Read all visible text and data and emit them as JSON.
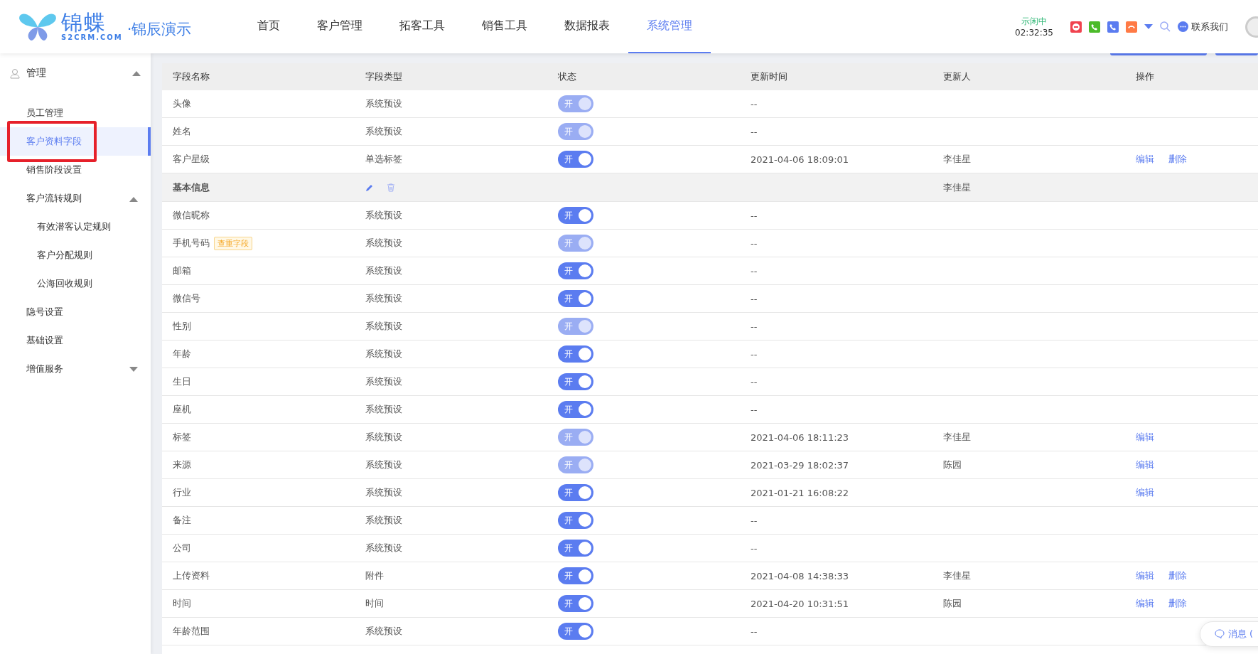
{
  "header": {
    "logo": {
      "mark": "锦蝶",
      "domain": "S2CRM.COM",
      "subtitle": "·锦辰演示"
    },
    "nav": [
      {
        "label": "首页",
        "selected": false
      },
      {
        "label": "客户管理",
        "selected": false
      },
      {
        "label": "拓客工具",
        "selected": false
      },
      {
        "label": "销售工具",
        "selected": false
      },
      {
        "label": "数据报表",
        "selected": false
      },
      {
        "label": "系统管理",
        "selected": true
      }
    ],
    "call_status": {
      "state": "示闲中",
      "timer": "02:32:35"
    },
    "contact": "联系我们"
  },
  "sidebar": {
    "items": [
      {
        "label": "管理",
        "expanded": true,
        "children": [
          {
            "label": "员工管理",
            "selected": false
          },
          {
            "label": "客户资料字段",
            "selected": true,
            "annotated": true
          },
          {
            "label": "销售阶段设置",
            "selected": false
          },
          {
            "label": "客户流转规则",
            "selected": false,
            "expanded": true,
            "children": [
              {
                "label": "有效潜客认定规则",
                "selected": false
              },
              {
                "label": "客户分配规则",
                "selected": false
              },
              {
                "label": "公海回收规则",
                "selected": false
              }
            ]
          },
          {
            "label": "隐号设置",
            "selected": false
          },
          {
            "label": "基础设置",
            "selected": false
          },
          {
            "label": "增值服务",
            "selected": false,
            "expanded": false
          }
        ]
      }
    ]
  },
  "table": {
    "columns": [
      "字段名称",
      "字段类型",
      "状态",
      "更新时间",
      "更新人",
      "操作"
    ],
    "rows": [
      {
        "kind": "field",
        "name": "头像",
        "type": "系统预设",
        "status": {
          "label": "开",
          "disabled": true
        },
        "time": "--"
      },
      {
        "kind": "field",
        "name": "姓名",
        "type": "系统预设",
        "status": {
          "label": "开",
          "disabled": true
        },
        "time": "--"
      },
      {
        "kind": "field",
        "name": "客户星级",
        "type": "单选标签",
        "status": {
          "label": "开",
          "disabled": false
        },
        "time": "2021-04-06 18:09:01",
        "updater": "李佳星",
        "actions": [
          "编辑",
          "删除"
        ]
      },
      {
        "kind": "group",
        "name": "基本信息",
        "updater": "李佳星"
      },
      {
        "kind": "field",
        "name": "微信昵称",
        "type": "系统预设",
        "status": {
          "label": "开",
          "disabled": false
        },
        "time": "--"
      },
      {
        "kind": "field",
        "name": "手机号码",
        "tag": "查重字段",
        "type": "系统预设",
        "status": {
          "label": "开",
          "disabled": true
        },
        "time": "--"
      },
      {
        "kind": "field",
        "name": "邮箱",
        "type": "系统预设",
        "status": {
          "label": "开",
          "disabled": false
        },
        "time": "--"
      },
      {
        "kind": "field",
        "name": "微信号",
        "type": "系统预设",
        "status": {
          "label": "开",
          "disabled": false
        },
        "time": "--"
      },
      {
        "kind": "field",
        "name": "性别",
        "type": "系统预设",
        "status": {
          "label": "开",
          "disabled": true
        },
        "time": "--"
      },
      {
        "kind": "field",
        "name": "年龄",
        "type": "系统预设",
        "status": {
          "label": "开",
          "disabled": false
        },
        "time": "--"
      },
      {
        "kind": "field",
        "name": "生日",
        "type": "系统预设",
        "status": {
          "label": "开",
          "disabled": false
        },
        "time": "--"
      },
      {
        "kind": "field",
        "name": "座机",
        "type": "系统预设",
        "status": {
          "label": "开",
          "disabled": false
        },
        "time": "--"
      },
      {
        "kind": "field",
        "name": "标签",
        "type": "系统预设",
        "status": {
          "label": "开",
          "disabled": true
        },
        "time": "2021-04-06 18:11:23",
        "updater": "李佳星",
        "actions": [
          "编辑"
        ]
      },
      {
        "kind": "field",
        "name": "来源",
        "type": "系统预设",
        "status": {
          "label": "开",
          "disabled": true
        },
        "time": "2021-03-29 18:02:37",
        "updater": "陈园",
        "actions": [
          "编辑"
        ]
      },
      {
        "kind": "field",
        "name": "行业",
        "type": "系统预设",
        "status": {
          "label": "开",
          "disabled": false
        },
        "time": "2021-01-21 16:08:22",
        "actions": [
          "编辑"
        ]
      },
      {
        "kind": "field",
        "name": "备注",
        "type": "系统预设",
        "status": {
          "label": "开",
          "disabled": false
        },
        "time": "--"
      },
      {
        "kind": "field",
        "name": "公司",
        "type": "系统预设",
        "status": {
          "label": "开",
          "disabled": false
        },
        "time": "--"
      },
      {
        "kind": "field",
        "name": "上传资料",
        "type": "附件",
        "status": {
          "label": "开",
          "disabled": false
        },
        "time": "2021-04-08 14:38:33",
        "updater": "李佳星",
        "actions": [
          "编辑",
          "删除"
        ]
      },
      {
        "kind": "field",
        "name": "时间",
        "type": "时间",
        "status": {
          "label": "开",
          "disabled": false
        },
        "time": "2021-04-20 10:31:51",
        "updater": "陈园",
        "actions": [
          "编辑",
          "删除"
        ]
      },
      {
        "kind": "field",
        "name": "年龄范围",
        "type": "系统预设",
        "status": {
          "label": "开",
          "disabled": false
        },
        "time": "--"
      }
    ]
  },
  "message_button": "消息 ("
}
